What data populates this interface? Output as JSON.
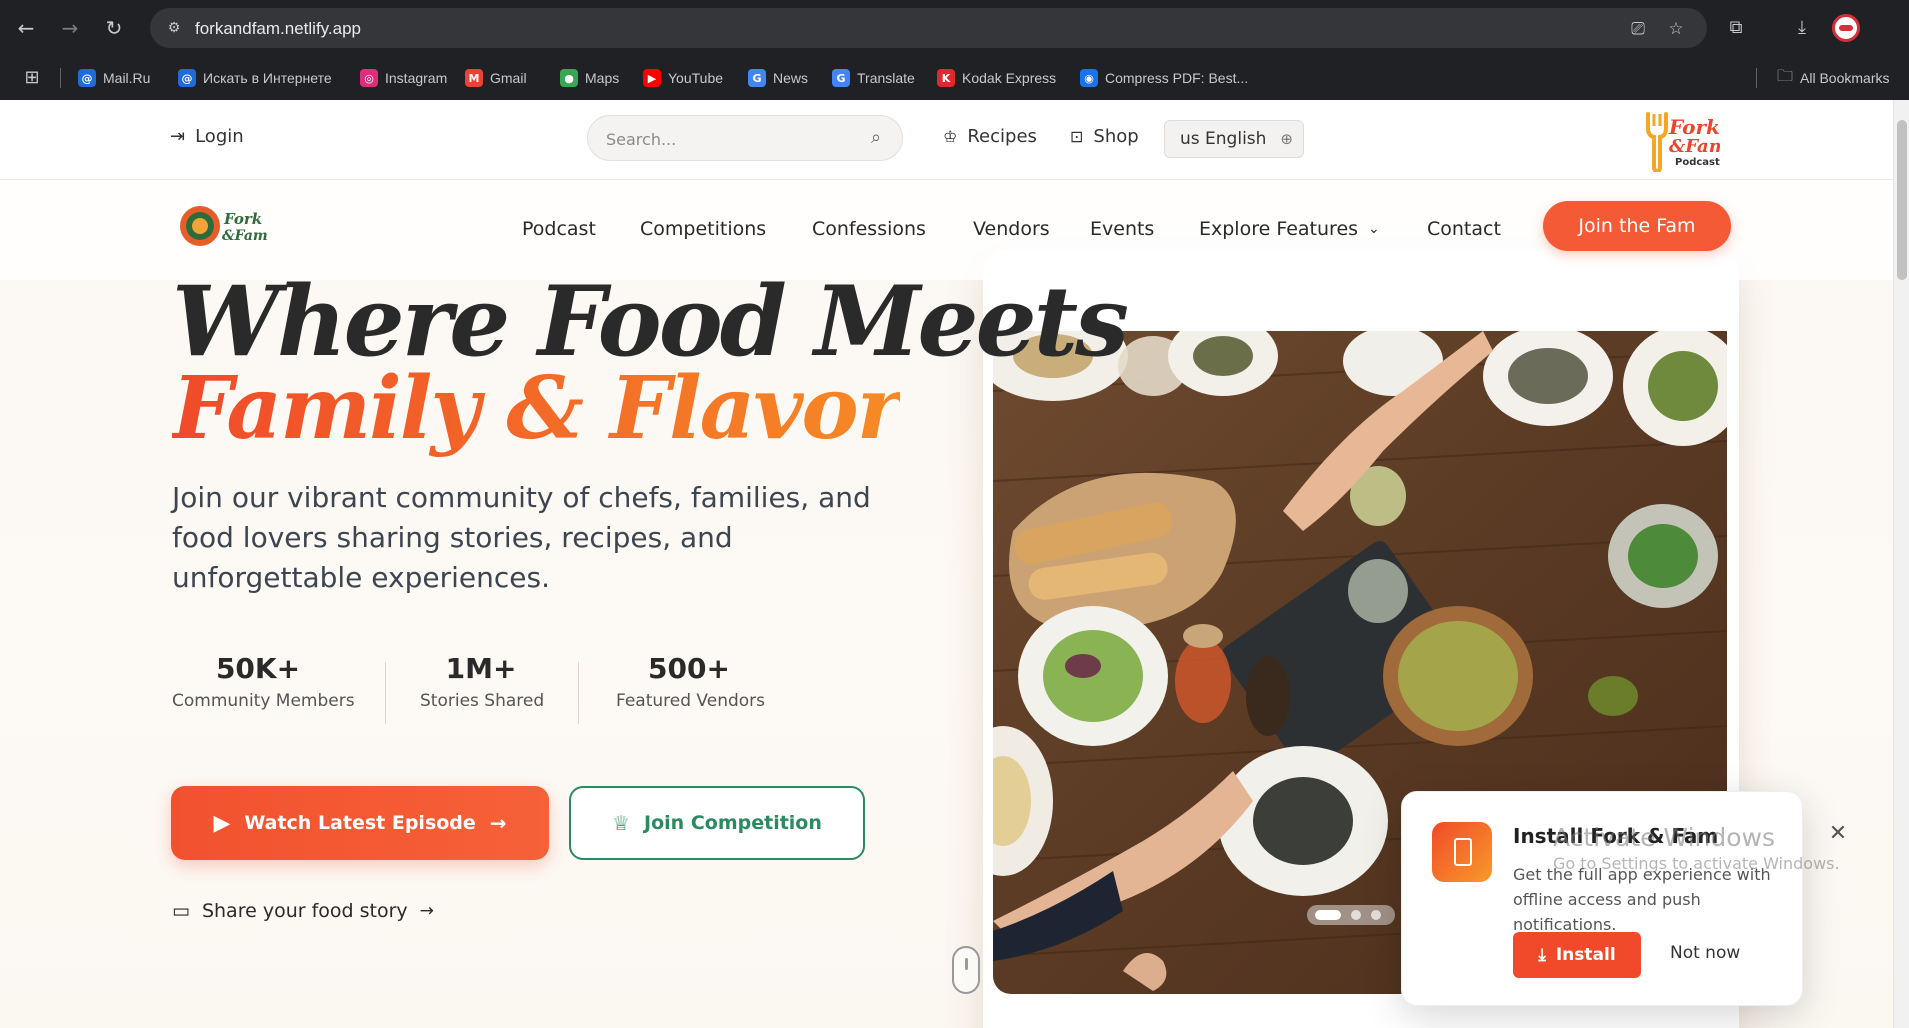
{
  "browser": {
    "url": "forkandfam.netlify.app",
    "bookmarks": [
      {
        "label": "Mail.Ru",
        "color": "#1e6cd8",
        "glyph": "@"
      },
      {
        "label": "Искать в Интернете",
        "color": "#1e6cd8",
        "glyph": "@"
      },
      {
        "label": "Instagram",
        "color": "#d92f7c",
        "glyph": "◎"
      },
      {
        "label": "Gmail",
        "color": "#ea4335",
        "glyph": "M"
      },
      {
        "label": "Maps",
        "color": "#34a853",
        "glyph": "●"
      },
      {
        "label": "YouTube",
        "color": "#ff0000",
        "glyph": "▶"
      },
      {
        "label": "News",
        "color": "#4285f4",
        "glyph": "G"
      },
      {
        "label": "Translate",
        "color": "#4285f4",
        "glyph": "G"
      },
      {
        "label": "Kodak Express",
        "color": "#e0282e",
        "glyph": "K"
      },
      {
        "label": "Compress PDF: Best...",
        "color": "#1a73e8",
        "glyph": "◉"
      }
    ],
    "all_bookmarks": "All Bookmarks"
  },
  "topbar": {
    "login": "Login",
    "search_placeholder": "Search...",
    "recipes": "Recipes",
    "shop": "Shop",
    "language": "us English",
    "brand_line1": "Fork",
    "brand_line2": "&Fam",
    "brand_line3": "Podcast"
  },
  "navbar": {
    "logo_line1": "Fork",
    "logo_line2": "&Fam",
    "items": [
      "Podcast",
      "Competitions",
      "Confessions",
      "Vendors",
      "Events",
      "Explore Features",
      "Contact"
    ],
    "cta": "Join the Fam"
  },
  "hero": {
    "title_line1": "Where Food Meets",
    "title_line2": "Family & Flavor",
    "subtitle": "Join our vibrant community of chefs, families, and food lovers sharing stories, recipes, and unforgettable experiences.",
    "stats": [
      {
        "value": "50K+",
        "label": "Community Members"
      },
      {
        "value": "1M+",
        "label": "Stories Shared"
      },
      {
        "value": "500+",
        "label": "Featured Vendors"
      }
    ],
    "watch_btn": "Watch Latest Episode",
    "competition_btn": "Join Competition",
    "share_link": "Share your food story"
  },
  "install_popup": {
    "title": "Install Fork & Fam",
    "description": "Get the full app experience with offline access and push notifications.",
    "install": "Install",
    "not_now": "Not now"
  },
  "watermark": {
    "line1": "Activate Windows",
    "line2": "Go to Settings to activate Windows."
  },
  "colors": {
    "accent": "#f45a35",
    "green": "#2c8a62",
    "chrome_bg": "#202124"
  }
}
